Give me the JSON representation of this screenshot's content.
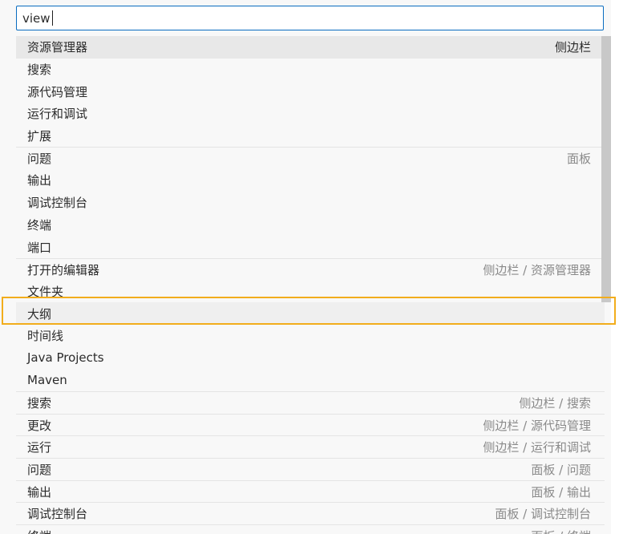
{
  "search": {
    "value": "view"
  },
  "rows": [
    {
      "label": "资源管理器",
      "detail": "侧边栏"
    },
    {
      "label": "搜索",
      "detail": ""
    },
    {
      "label": "源代码管理",
      "detail": ""
    },
    {
      "label": "运行和调试",
      "detail": ""
    },
    {
      "label": "扩展",
      "detail": ""
    },
    {
      "label": "问题",
      "detail": "面板"
    },
    {
      "label": "输出",
      "detail": ""
    },
    {
      "label": "调试控制台",
      "detail": ""
    },
    {
      "label": "终端",
      "detail": ""
    },
    {
      "label": "端口",
      "detail": ""
    },
    {
      "label": "打开的编辑器",
      "detail": "侧边栏 / 资源管理器"
    },
    {
      "label": "文件夹",
      "detail": ""
    },
    {
      "label": "大纲",
      "detail": ""
    },
    {
      "label": "时间线",
      "detail": ""
    },
    {
      "label": "Java Projects",
      "detail": ""
    },
    {
      "label": "Maven",
      "detail": ""
    },
    {
      "label": "搜索",
      "detail": "侧边栏 / 搜索"
    },
    {
      "label": "更改",
      "detail": "侧边栏 / 源代码管理"
    },
    {
      "label": "运行",
      "detail": "侧边栏 / 运行和调试"
    },
    {
      "label": "问题",
      "detail": "面板 / 问题"
    },
    {
      "label": "输出",
      "detail": "面板 / 输出"
    },
    {
      "label": "调试控制台",
      "detail": "面板 / 调试控制台"
    },
    {
      "label": "终端",
      "detail": "面板 / 终端"
    }
  ]
}
